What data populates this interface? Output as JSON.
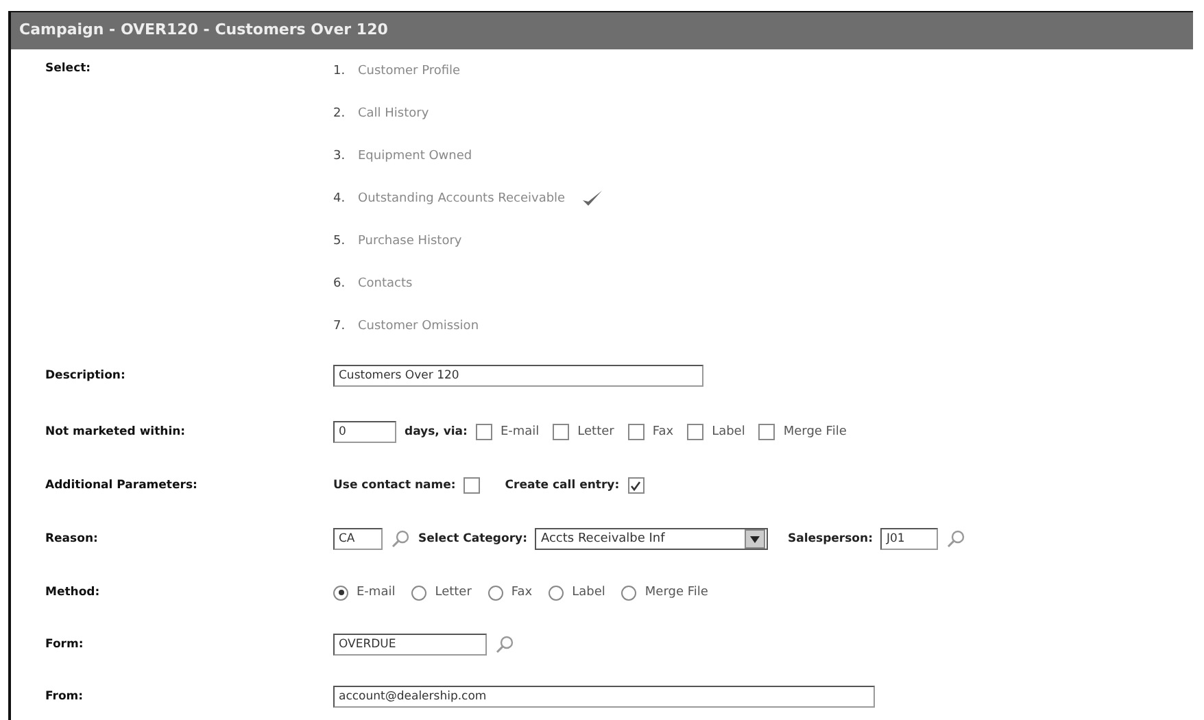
{
  "window": {
    "title": "Campaign - OVER120 - Customers Over 120"
  },
  "select": {
    "label": "Select:",
    "items": [
      {
        "number": "1.",
        "text": "Customer Profile",
        "checked": false
      },
      {
        "number": "2.",
        "text": "Call History",
        "checked": false
      },
      {
        "number": "3.",
        "text": "Equipment Owned",
        "checked": false
      },
      {
        "number": "4.",
        "text": "Outstanding Accounts Receivable",
        "checked": true
      },
      {
        "number": "5.",
        "text": "Purchase History",
        "checked": false
      },
      {
        "number": "6.",
        "text": "Contacts",
        "checked": false
      },
      {
        "number": "7.",
        "text": "Customer Omission",
        "checked": false
      }
    ]
  },
  "description": {
    "label": "Description:",
    "value": "Customers Over 120"
  },
  "not_marketed": {
    "label": "Not marketed within:",
    "value": "0",
    "suffix": "days, via:",
    "options": [
      {
        "label": "E-mail",
        "checked": false
      },
      {
        "label": "Letter",
        "checked": false
      },
      {
        "label": "Fax",
        "checked": false
      },
      {
        "label": "Label",
        "checked": false
      },
      {
        "label": "Merge File",
        "checked": false
      }
    ]
  },
  "additional": {
    "label": "Additional Parameters:",
    "options": [
      {
        "label": "Use contact name:",
        "checked": false
      },
      {
        "label": "Create call entry:",
        "checked": true
      }
    ]
  },
  "reason": {
    "label": "Reason:",
    "value": "CA",
    "category_label": "Select Category:",
    "category_value": "Accts Receivalbe Inf",
    "salesperson_label": "Salesperson:",
    "salesperson_value": "J01"
  },
  "method": {
    "label": "Method:",
    "options": [
      {
        "label": "E-mail",
        "selected": true
      },
      {
        "label": "Letter",
        "selected": false
      },
      {
        "label": "Fax",
        "selected": false
      },
      {
        "label": "Label",
        "selected": false
      },
      {
        "label": "Merge File",
        "selected": false
      }
    ]
  },
  "form": {
    "label": "Form:",
    "value": "OVERDUE"
  },
  "from": {
    "label": "From:",
    "value": "account@dealership.com"
  }
}
